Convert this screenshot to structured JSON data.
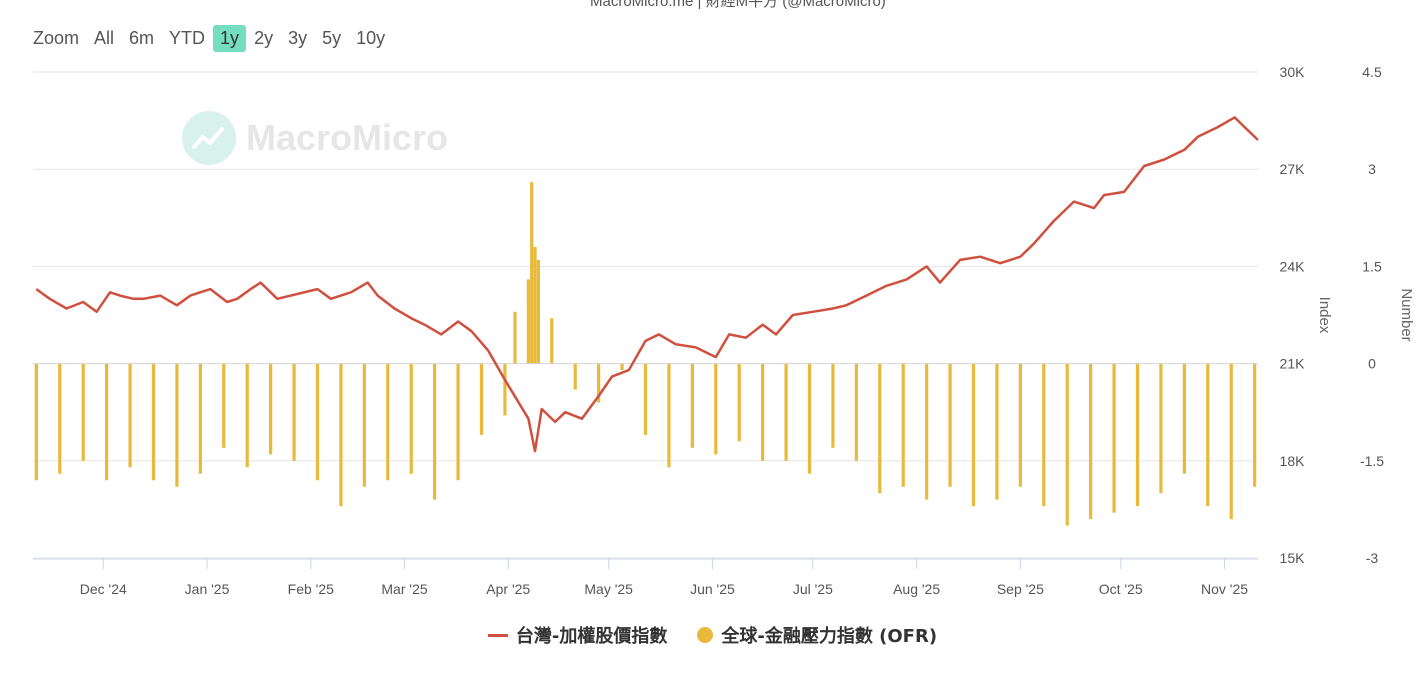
{
  "source_label": "MacroMicro.me | 財經M平方 (@MacroMicro)",
  "watermark": "MacroMicro",
  "zoom": {
    "label": "Zoom",
    "buttons": [
      "All",
      "6m",
      "YTD",
      "1y",
      "2y",
      "3y",
      "5y",
      "10y"
    ],
    "active": "1y"
  },
  "colors": {
    "index_line": "#d0503f",
    "ofr_bar": "#e8b93a",
    "zoom_active": "#75ddc0"
  },
  "chart_data": {
    "type": "line+bar",
    "x_ticks": [
      "Dec '24",
      "Jan '25",
      "Feb '25",
      "Mar '25",
      "Apr '25",
      "May '25",
      "Jun '25",
      "Jul '25",
      "Aug '25",
      "Sep '25",
      "Oct '25",
      "Nov '25"
    ],
    "x_range": [
      "2024-11-10",
      "2025-11-11"
    ],
    "y_left": {
      "label": "Index",
      "ticks": [
        "30K",
        "27K",
        "24K",
        "21K",
        "18K",
        "15K"
      ],
      "range": [
        15000,
        30000
      ]
    },
    "y_right": {
      "label": "Number",
      "ticks": [
        "4.5",
        "3",
        "1.5",
        "0",
        "-1.5",
        "-3"
      ],
      "range": [
        -3,
        4.5
      ]
    },
    "grid": true,
    "legend_position": "bottom-center",
    "series": [
      {
        "name": "台灣-加權股價指數",
        "axis": "left",
        "type": "line",
        "x": [
          "2024-11-11",
          "2024-11-15",
          "2024-11-20",
          "2024-11-25",
          "2024-11-29",
          "2024-12-03",
          "2024-12-06",
          "2024-12-10",
          "2024-12-13",
          "2024-12-18",
          "2024-12-23",
          "2024-12-27",
          "2025-01-02",
          "2025-01-07",
          "2025-01-10",
          "2025-01-14",
          "2025-01-17",
          "2025-01-22",
          "2025-02-03",
          "2025-02-07",
          "2025-02-13",
          "2025-02-18",
          "2025-02-21",
          "2025-02-26",
          "2025-03-03",
          "2025-03-07",
          "2025-03-12",
          "2025-03-17",
          "2025-03-21",
          "2025-03-26",
          "2025-03-31",
          "2025-04-07",
          "2025-04-09",
          "2025-04-11",
          "2025-04-15",
          "2025-04-18",
          "2025-04-23",
          "2025-04-28",
          "2025-05-02",
          "2025-05-07",
          "2025-05-12",
          "2025-05-16",
          "2025-05-21",
          "2025-05-27",
          "2025-06-02",
          "2025-06-06",
          "2025-06-11",
          "2025-06-16",
          "2025-06-20",
          "2025-06-25",
          "2025-07-01",
          "2025-07-07",
          "2025-07-11",
          "2025-07-17",
          "2025-07-23",
          "2025-07-29",
          "2025-08-04",
          "2025-08-08",
          "2025-08-14",
          "2025-08-20",
          "2025-08-26",
          "2025-09-01",
          "2025-09-05",
          "2025-09-11",
          "2025-09-17",
          "2025-09-23",
          "2025-09-26",
          "2025-10-02",
          "2025-10-08",
          "2025-10-14",
          "2025-10-20",
          "2025-10-24",
          "2025-10-30",
          "2025-11-04",
          "2025-11-07",
          "2025-11-11"
        ],
        "values": [
          23300,
          23000,
          22700,
          22900,
          22600,
          23200,
          23100,
          23000,
          23000,
          23100,
          22800,
          23100,
          23300,
          22900,
          23000,
          23300,
          23500,
          23000,
          23300,
          23000,
          23200,
          23500,
          23100,
          22700,
          22400,
          22200,
          21900,
          22300,
          22000,
          21400,
          20500,
          19300,
          18300,
          19600,
          19200,
          19500,
          19300,
          20000,
          20600,
          20800,
          21700,
          21900,
          21600,
          21500,
          21200,
          21900,
          21800,
          22200,
          21900,
          22500,
          22600,
          22700,
          22800,
          23100,
          23400,
          23600,
          24000,
          23500,
          24200,
          24300,
          24100,
          24300,
          24700,
          25400,
          26000,
          25800,
          26200,
          26300,
          27100,
          27300,
          27600,
          28000,
          28300,
          28600,
          28300,
          27900
        ]
      },
      {
        "name": "全球-金融壓力指數 (OFR)",
        "axis": "right",
        "type": "bar",
        "x": [
          "2024-11-11",
          "2024-11-18",
          "2024-11-25",
          "2024-12-02",
          "2024-12-09",
          "2024-12-16",
          "2024-12-23",
          "2024-12-30",
          "2025-01-06",
          "2025-01-13",
          "2025-01-20",
          "2025-01-27",
          "2025-02-03",
          "2025-02-10",
          "2025-02-17",
          "2025-02-24",
          "2025-03-03",
          "2025-03-10",
          "2025-03-17",
          "2025-03-24",
          "2025-03-31",
          "2025-04-03",
          "2025-04-07",
          "2025-04-08",
          "2025-04-09",
          "2025-04-10",
          "2025-04-14",
          "2025-04-21",
          "2025-04-28",
          "2025-05-05",
          "2025-05-12",
          "2025-05-19",
          "2025-05-26",
          "2025-06-02",
          "2025-06-09",
          "2025-06-16",
          "2025-06-23",
          "2025-06-30",
          "2025-07-07",
          "2025-07-14",
          "2025-07-21",
          "2025-07-28",
          "2025-08-04",
          "2025-08-11",
          "2025-08-18",
          "2025-08-25",
          "2025-09-01",
          "2025-09-08",
          "2025-09-15",
          "2025-09-22",
          "2025-09-29",
          "2025-10-06",
          "2025-10-13",
          "2025-10-20",
          "2025-10-27",
          "2025-11-03",
          "2025-11-10"
        ],
        "values": [
          -1.8,
          -1.7,
          -1.5,
          -1.8,
          -1.6,
          -1.8,
          -1.9,
          -1.7,
          -1.3,
          -1.6,
          -1.4,
          -1.5,
          -1.8,
          -2.2,
          -1.9,
          -1.8,
          -1.7,
          -2.1,
          -1.8,
          -1.1,
          -0.8,
          0.8,
          1.3,
          2.8,
          1.8,
          1.6,
          0.7,
          -0.4,
          -0.6,
          -0.1,
          -1.1,
          -1.6,
          -1.3,
          -1.4,
          -1.2,
          -1.5,
          -1.5,
          -1.7,
          -1.3,
          -1.5,
          -2.0,
          -1.9,
          -2.1,
          -1.9,
          -2.2,
          -2.1,
          -1.9,
          -2.2,
          -2.5,
          -2.4,
          -2.3,
          -2.2,
          -2.0,
          -1.7,
          -2.2,
          -2.4,
          -1.9
        ]
      }
    ]
  }
}
